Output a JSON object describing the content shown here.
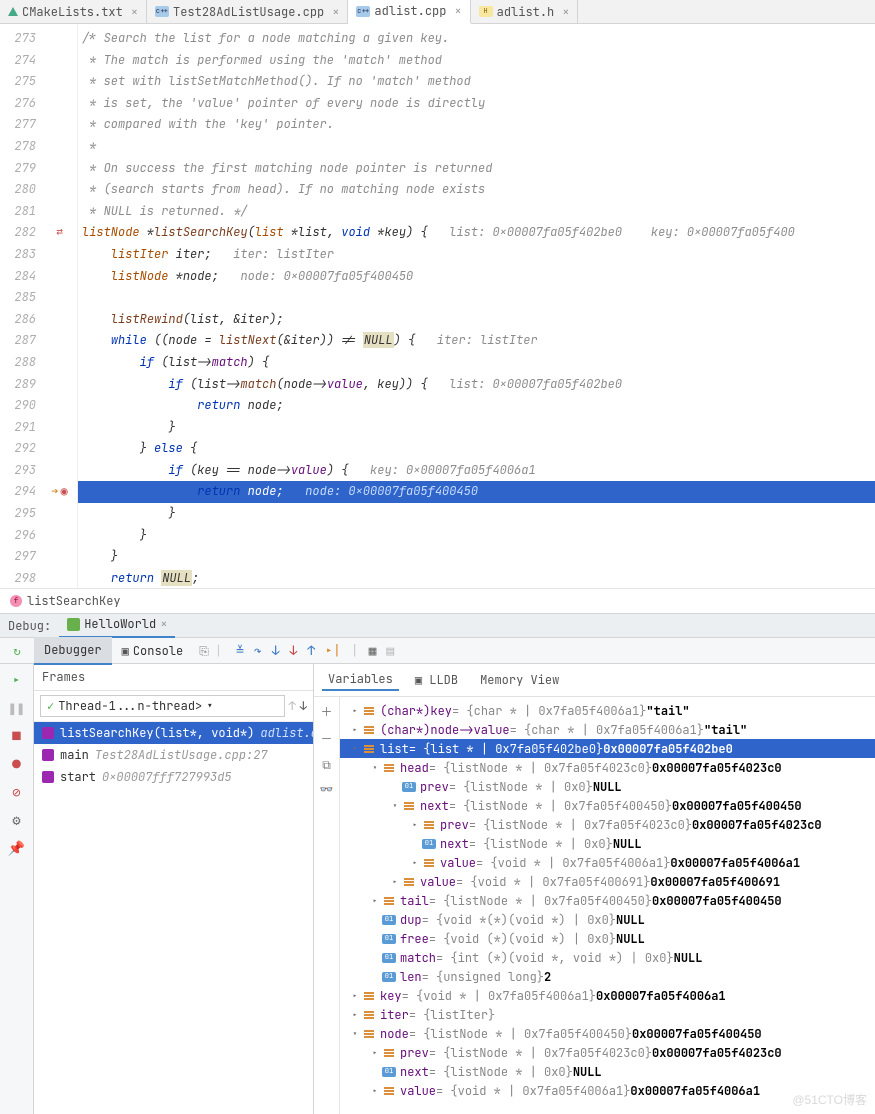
{
  "tabs": [
    {
      "icon": "tri",
      "label": "CMakeLists.txt"
    },
    {
      "icon": "cpp",
      "label": "Test28AdListUsage.cpp"
    },
    {
      "icon": "cpp",
      "label": "adlist.cpp",
      "active": true
    },
    {
      "icon": "h",
      "label": "adlist.h"
    }
  ],
  "gutter_start": 273,
  "code_lines": [
    {
      "t": "/* Search the list for a node matching a given key.",
      "cls": "cm"
    },
    {
      "t": " * The match is performed using the 'match' method",
      "cls": "cm"
    },
    {
      "t": " * set with listSetMatchMethod(). If no 'match' method",
      "cls": "cm"
    },
    {
      "t": " * is set, the 'value' pointer of every node is directly",
      "cls": "cm"
    },
    {
      "t": " * compared with the 'key' pointer.",
      "cls": "cm"
    },
    {
      "t": " *",
      "cls": "cm"
    },
    {
      "t": " * On success the first matching node pointer is returned",
      "cls": "cm"
    },
    {
      "t": " * (search starts from head). If no matching node exists",
      "cls": "cm"
    },
    {
      "t": " * NULL is returned. */",
      "cls": "cm"
    },
    {
      "raw": "<span class='ty'>listNode</span> *<span class='fn'>listSearchKey</span>(<span class='ty'>list</span> *list, <span class='kw'>void</span> *key) {   <span class='hint'>list: 0x00007fa05f402be0    key: 0x00007fa05f400</span>",
      "marker": "loop"
    },
    {
      "raw": "    <span class='ty'>listIter</span> iter;   <span class='hint'>iter: listIter</span>"
    },
    {
      "raw": "    <span class='ty'>listNode</span> *node;   <span class='hint'>node: 0x00007fa05f400450</span>"
    },
    {
      "t": ""
    },
    {
      "raw": "    <span class='fn'>listRewind</span>(list, &iter);"
    },
    {
      "raw": "    <span class='kw'>while</span> ((node = <span class='fn'>listNext</span>(&iter)) != <span class='hl'>NULL</span>) {   <span class='hint'>iter: listIter</span>"
    },
    {
      "raw": "        <span class='kw'>if</span> (list-><span class='id'>match</span>) {"
    },
    {
      "raw": "            <span class='kw'>if</span> (list-><span class='fn'>match</span>(node-><span class='id'>value</span>, key)) {   <span class='hint'>list: 0x00007fa05f402be0</span>"
    },
    {
      "raw": "                <span class='kw'>return</span> node;"
    },
    {
      "raw": "            }"
    },
    {
      "raw": "        } <span class='kw'>else</span> {"
    },
    {
      "raw": "            <span class='kw'>if</span> (key == node-><span class='id'>value</span>) {   <span class='hint'>key: 0x00007fa05f4006a1</span>"
    },
    {
      "raw": "                <span class='kw'>return</span> node;   <span class='hint'>node: 0x00007fa05f400450</span>",
      "current": true,
      "marker": "bp"
    },
    {
      "raw": "            }"
    },
    {
      "raw": "        }"
    },
    {
      "raw": "    }"
    },
    {
      "raw": "    <span class='kw'>return</span> <span class='hl'>NULL</span>;"
    }
  ],
  "breadcrumb": {
    "fn": "listSearchKey"
  },
  "debug": {
    "label": "Debug:",
    "config": "HelloWorld"
  },
  "debugger_tabs": {
    "debugger": "Debugger",
    "console": "Console"
  },
  "frames": {
    "title": "Frames",
    "thread": "Thread-1...n-thread>",
    "items": [
      {
        "label": "listSearchKey(list*, void*)",
        "loc": "adlist.cpp",
        "sel": true
      },
      {
        "label": "main",
        "loc": "Test28AdListUsage.cpp:27"
      },
      {
        "label": "start",
        "loc": "0x00007fff727993d5"
      }
    ]
  },
  "var_tabs": {
    "vars": "Variables",
    "lldb": "LLDB",
    "mem": "Memory View"
  },
  "variables": [
    {
      "d": 0,
      "a": "r",
      "i": "obj",
      "n": "(char*)key",
      "g": " = {char * | 0x7fa05f4006a1}",
      "b": " \"tail\""
    },
    {
      "d": 0,
      "a": "r",
      "i": "obj",
      "n": "(char*)node->value",
      "g": " = {char * | 0x7fa05f4006a1}",
      "b": " \"tail\""
    },
    {
      "d": 0,
      "a": "d",
      "i": "obj",
      "n": "list",
      "g": " = {list * | 0x7fa05f402be0}",
      "b": " 0x00007fa05f402be0",
      "sel": true
    },
    {
      "d": 1,
      "a": "d",
      "i": "obj",
      "n": "head",
      "g": " = {listNode * | 0x7fa05f4023c0}",
      "b": " 0x00007fa05f4023c0"
    },
    {
      "d": 2,
      "a": "",
      "i": "prim",
      "n": "prev",
      "g": " = {listNode * | 0x0}",
      "b": " NULL"
    },
    {
      "d": 2,
      "a": "d",
      "i": "obj",
      "n": "next",
      "g": " = {listNode * | 0x7fa05f400450}",
      "b": " 0x00007fa05f400450"
    },
    {
      "d": 3,
      "a": "r",
      "i": "obj",
      "n": "prev",
      "g": " = {listNode * | 0x7fa05f4023c0}",
      "b": " 0x00007fa05f4023c0"
    },
    {
      "d": 3,
      "a": "",
      "i": "prim",
      "n": "next",
      "g": " = {listNode * | 0x0}",
      "b": " NULL"
    },
    {
      "d": 3,
      "a": "r",
      "i": "obj",
      "n": "value",
      "g": " = {void * | 0x7fa05f4006a1}",
      "b": " 0x00007fa05f4006a1"
    },
    {
      "d": 2,
      "a": "r",
      "i": "obj",
      "n": "value",
      "g": " = {void * | 0x7fa05f400691}",
      "b": " 0x00007fa05f400691"
    },
    {
      "d": 1,
      "a": "r",
      "i": "obj",
      "n": "tail",
      "g": " = {listNode * | 0x7fa05f400450}",
      "b": " 0x00007fa05f400450"
    },
    {
      "d": 1,
      "a": "",
      "i": "prim",
      "n": "dup",
      "g": " = {void *(*)(void *) | 0x0}",
      "b": " NULL"
    },
    {
      "d": 1,
      "a": "",
      "i": "prim",
      "n": "free",
      "g": " = {void (*)(void *) | 0x0}",
      "b": " NULL"
    },
    {
      "d": 1,
      "a": "",
      "i": "prim",
      "n": "match",
      "g": " = {int (*)(void *, void *) | 0x0}",
      "b": " NULL"
    },
    {
      "d": 1,
      "a": "",
      "i": "prim",
      "n": "len",
      "g": " = {unsigned long}",
      "b": " 2"
    },
    {
      "d": 0,
      "a": "r",
      "i": "obj",
      "n": "key",
      "g": " = {void * | 0x7fa05f4006a1}",
      "b": " 0x00007fa05f4006a1"
    },
    {
      "d": 0,
      "a": "r",
      "i": "obj",
      "n": "iter",
      "g": " = {listIter}",
      "b": ""
    },
    {
      "d": 0,
      "a": "d",
      "i": "obj",
      "n": "node",
      "g": " = {listNode * | 0x7fa05f400450}",
      "b": " 0x00007fa05f400450"
    },
    {
      "d": 1,
      "a": "r",
      "i": "obj",
      "n": "prev",
      "g": " = {listNode * | 0x7fa05f4023c0}",
      "b": " 0x00007fa05f4023c0"
    },
    {
      "d": 1,
      "a": "",
      "i": "prim",
      "n": "next",
      "g": " = {listNode * | 0x0}",
      "b": " NULL"
    },
    {
      "d": 1,
      "a": "r",
      "i": "obj",
      "n": "value",
      "g": " = {void * | 0x7fa05f4006a1}",
      "b": " 0x00007fa05f4006a1"
    }
  ],
  "watermark": "@51CTO博客"
}
